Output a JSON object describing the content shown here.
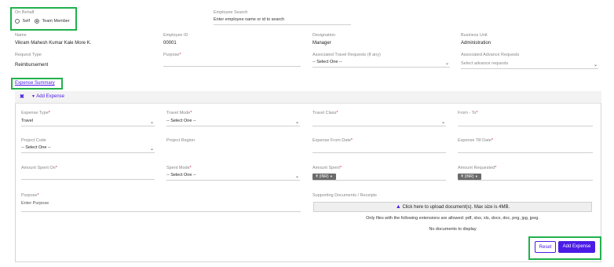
{
  "onbehalf": {
    "label": "On Behalf",
    "options": [
      {
        "label": "Self",
        "selected": false
      },
      {
        "label": "Team Member",
        "selected": true
      }
    ]
  },
  "employee_search": {
    "label": "Employee Search",
    "placeholder": "Enter employee name or id to search"
  },
  "employee": {
    "name_label": "Name",
    "name_value": "Vikram Mahesh Kumar Kale More K.",
    "id_label": "Employee ID",
    "id_value": "00001",
    "designation_label": "Designation",
    "designation_value": "Manager",
    "bu_label": "Business Unit",
    "bu_value": "Administration"
  },
  "request": {
    "type_label": "Request Type",
    "type_value": "Reimbursement",
    "purpose_label": "Purpose",
    "travel_label": "Associated Travel Requests (If any)",
    "travel_value": "-- Select One --",
    "advance_label": "Associated Advance Requests",
    "advance_placeholder": "Select advance requests"
  },
  "section_title": "Expense Summary",
  "add_expense_link": "Add Expense",
  "form": {
    "expense_type_label": "Expense Type",
    "expense_type_value": "Travel",
    "travel_mode_label": "Travel Mode",
    "travel_mode_value": "-- Select One --",
    "travel_class_label": "Travel Class",
    "from_to_label": "From - To",
    "project_code_label": "Project Code",
    "project_code_value": "-- Select One --",
    "project_region_label": "Project Region",
    "from_date_label": "Expense From Date",
    "till_date_label": "Expense Till Date",
    "amount_spent_on_label": "Amount Spent On",
    "spent_mode_label": "Spent Mode",
    "spent_mode_value": "-- Select One --",
    "amount_spent_label": "Amount Spent",
    "amount_spent_currency": "₹ (INR)",
    "amount_requested_label": "Amount Requested",
    "amount_requested_currency": "₹ (INR)",
    "purpose_label": "Purpose",
    "purpose_placeholder": "Enter Purpose",
    "docs_label": "Supporting Documents / Receipts",
    "upload_text": "Click here to upload document(s). Max size is 4MB.",
    "ext_note": "Only files with the following extensions are allowed: pdf, xlsx, xls, docx, doc, png, jpg, jpeg.",
    "no_docs": "No documents to display"
  },
  "buttons": {
    "reset": "Reset",
    "add": "Add Expense"
  },
  "colors": {
    "accent": "#4b1ce6",
    "highlight": "#22b14c",
    "required": "#d81b60"
  }
}
